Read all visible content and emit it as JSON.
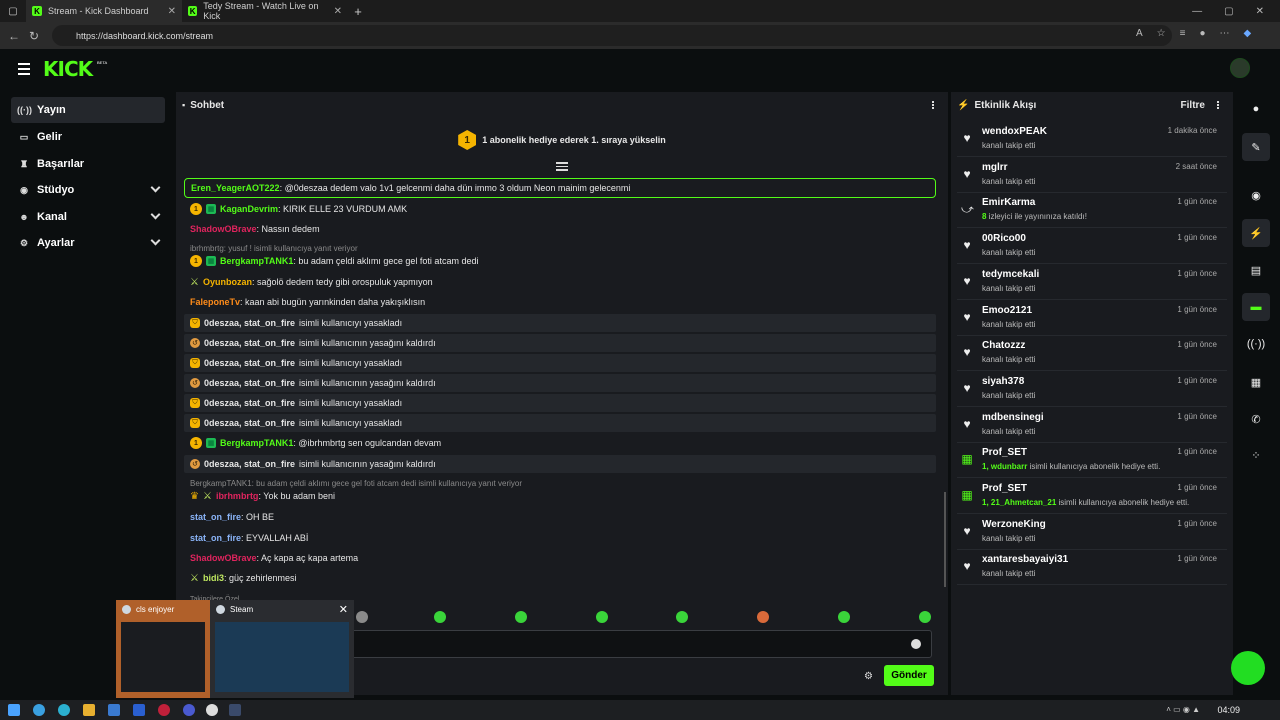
{
  "browser": {
    "tabs": [
      {
        "title": "Stream - Kick Dashboard",
        "active": true
      },
      {
        "title": "Tedy Stream - Watch Live on Kick",
        "active": false
      }
    ],
    "url": "https://dashboard.kick.com/stream"
  },
  "header": {
    "logo": "KICK",
    "beta": "BETA"
  },
  "sidebar": {
    "items": [
      {
        "label": "Yayın",
        "icon": "broadcast-icon"
      },
      {
        "label": "Gelir",
        "icon": "money-icon"
      },
      {
        "label": "Başarılar",
        "icon": "trophy-icon"
      },
      {
        "label": "Stüdyo",
        "icon": "studio-icon"
      },
      {
        "label": "Kanal",
        "icon": "channel-icon"
      },
      {
        "label": "Ayarlar",
        "icon": "gear-icon"
      }
    ]
  },
  "chat": {
    "title": "Sohbet",
    "pinned": {
      "badge": "1",
      "text": "1 abonelik hediye ederek 1. sıraya yükselin"
    },
    "messages": [
      {
        "user": "Eren_YeagerAOT222",
        "color": "#53fc18",
        "text": ": @0deszaa dedem valo 1v1 gelcenmi daha dün immo 3 oldum Neon mainim gelecenmi",
        "type": "hl"
      },
      {
        "user": "KaganDevrim",
        "color": "#53fc18",
        "text": ": KIRIK ELLE 23 VURDUM AMK",
        "badges": [
          "1",
          "gift"
        ]
      },
      {
        "user": "ShadowOBrave",
        "color": "#e0245e",
        "text": ": Nassın dedem"
      },
      {
        "reply": "ibrhmbrtg: yusuf ! isimli kullanıcıya yanıt veriyor"
      },
      {
        "user": "BergkampTANK1",
        "color": "#53fc18",
        "text": ": bu adam çeldi aklımı gece gel foti atcam dedi",
        "badges": [
          "1",
          "gift"
        ]
      },
      {
        "user": "Oyunbozan",
        "color": "#f5b400",
        "text": ": sağolö dedem tedy gibi orospuluk yapmıyon",
        "badges": [
          "sword"
        ]
      },
      {
        "user": "FaleponeTv",
        "color": "#ff8c1a",
        "text": ": kaan abi bugün yarınkinden daha yakışıklısın"
      },
      {
        "mod": "0deszaa, stat_on_fire",
        "action": "isimli kullanıcıyı yasakladı",
        "kind": "ban"
      },
      {
        "mod": "0deszaa, stat_on_fire",
        "action": "isimli kullanıcının yasağını kaldırdı",
        "kind": "unban"
      },
      {
        "mod": "0deszaa, stat_on_fire",
        "action": "isimli kullanıcıyı yasakladı",
        "kind": "ban"
      },
      {
        "mod": "0deszaa, stat_on_fire",
        "action": "isimli kullanıcının yasağını kaldırdı",
        "kind": "unban"
      },
      {
        "mod": "0deszaa, stat_on_fire",
        "action": "isimli kullanıcıyı yasakladı",
        "kind": "ban"
      },
      {
        "mod": "0deszaa, stat_on_fire",
        "action": "isimli kullanıcıyı yasakladı",
        "kind": "ban"
      },
      {
        "user": "BergkampTANK1",
        "color": "#53fc18",
        "text": ": @ibrhmbrtg sen ogulcandan devam",
        "badges": [
          "1",
          "gift"
        ]
      },
      {
        "mod": "0deszaa, stat_on_fire",
        "action": "isimli kullanıcının yasağını kaldırdı",
        "kind": "unban"
      },
      {
        "reply": "BergkampTANK1: bu adam çeldi aklımı gece gel foti atcam dedi isimli kullanıcıya yanıt veriyor"
      },
      {
        "user": "ibrhmbrtg",
        "color": "#e0245e",
        "text": ": Yok bu adam beni",
        "badges": [
          "crown",
          "sword"
        ]
      },
      {
        "user": "stat_on_fire",
        "color": "#8ab4f8",
        "text": ": OH BE"
      },
      {
        "user": "stat_on_fire",
        "color": "#8ab4f8",
        "text": ": EYVALLAH ABİ"
      },
      {
        "user": "ShadowOBrave",
        "color": "#e0245e",
        "text": ": Aç kapa aç kapa artema"
      },
      {
        "user": "bidi3",
        "color": "#c0e860",
        "text": ": güç zehirlenmesi",
        "badges": [
          "sword"
        ]
      }
    ],
    "followers_only": "Takipçilere Özel",
    "send_label": "Gönder"
  },
  "activity": {
    "title": "Etkinlik Akışı",
    "filter_label": "Filtre",
    "events": [
      {
        "name": "wendoxPEAK",
        "desc": "kanalı takip etti",
        "time": "1 dakika önce",
        "icon": "heart-icon"
      },
      {
        "name": "mglrr",
        "desc": "kanalı takip etti",
        "time": "2 saat önce",
        "icon": "heart-icon"
      },
      {
        "name": "EmirKarma",
        "desc_hl": "8",
        "desc": " izleyici ile yayınınıza katıldı!",
        "time": "1 gün önce",
        "icon": "raid-icon"
      },
      {
        "name": "00Rico00",
        "desc": "kanalı takip etti",
        "time": "1 gün önce",
        "icon": "heart-icon"
      },
      {
        "name": "tedymcekali",
        "desc": "kanalı takip etti",
        "time": "1 gün önce",
        "icon": "heart-icon"
      },
      {
        "name": "Emoo2121",
        "desc": "kanalı takip etti",
        "time": "1 gün önce",
        "icon": "heart-icon"
      },
      {
        "name": "Chatozzz",
        "desc": "kanalı takip etti",
        "time": "1 gün önce",
        "icon": "heart-icon"
      },
      {
        "name": "siyah378",
        "desc": "kanalı takip etti",
        "time": "1 gün önce",
        "icon": "heart-icon"
      },
      {
        "name": "mdbensinegi",
        "desc": "kanalı takip etti",
        "time": "1 gün önce",
        "icon": "heart-icon"
      },
      {
        "name": "Prof_SET",
        "desc_hl": "1, wdunbarr",
        "desc": " isimli kullanıcıya abonelik hediye etti.",
        "time": "1 gün önce",
        "icon": "gift-icon"
      },
      {
        "name": "Prof_SET",
        "desc_hl": "1, 21_Ahmetcan_21",
        "desc": " isimli kullanıcıya abonelik hediye etti.",
        "time": "1 gün önce",
        "icon": "gift-icon"
      },
      {
        "name": "WerzoneKing",
        "desc": "kanalı takip etti",
        "time": "1 gün önce",
        "icon": "heart-icon"
      },
      {
        "name": "xantaresbayaiyi31",
        "desc": "kanalı takip etti",
        "time": "1 gün önce",
        "icon": "heart-icon"
      }
    ]
  },
  "taskbar": {
    "clock": "04:09",
    "thumbnails": [
      {
        "title": "cls enjoyer"
      },
      {
        "title": "Steam"
      }
    ]
  },
  "colors": {
    "accent": "#53fc18",
    "panel": "#191b1f",
    "background": "#0b0e0f"
  }
}
